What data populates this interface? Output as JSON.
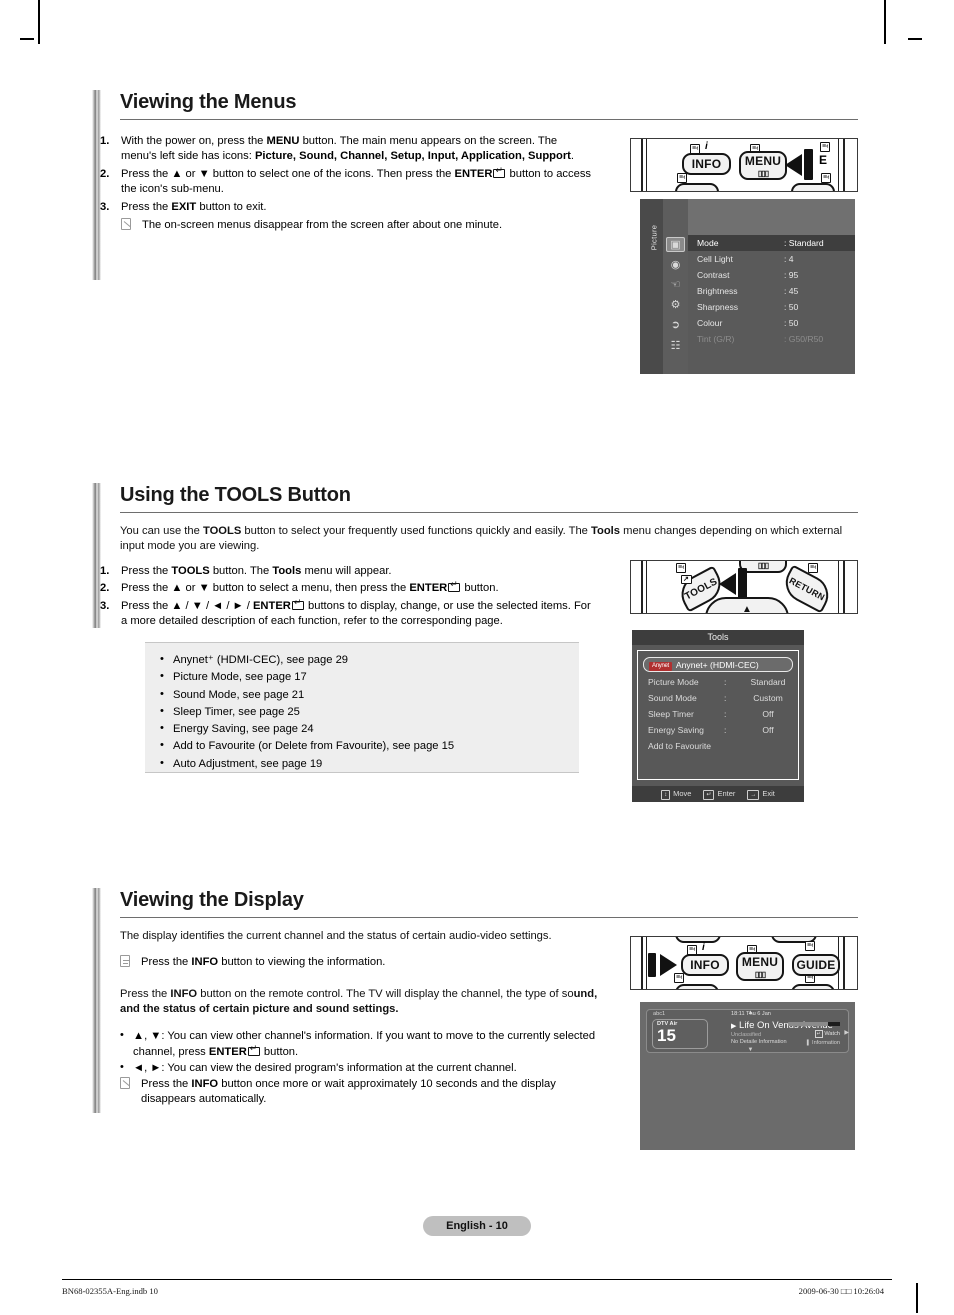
{
  "sections": [
    {
      "id": "viewing-menus",
      "title": "Viewing the Menus",
      "steps": [
        {
          "num": "1.",
          "html": "With the power on, press the <b>MENU</b> button. The main menu appears on the screen. The menu's left side has icons: <b>Picture, Sound, Channel, Setup, Input, Application, Support</b>."
        },
        {
          "num": "2.",
          "html": "Press the ▲ or ▼ button to select one of the icons. Then press the <b>ENTER</b><key></key> button to access the icon's sub-menu."
        },
        {
          "num": "3.",
          "html": "Press the <b>EXIT</b> button to exit."
        }
      ],
      "note": "The on-screen menus disappear from the screen after about one minute."
    },
    {
      "id": "using-tools",
      "title": "Using the TOOLS Button",
      "intro": "You can use the <b>TOOLS</b> button to select your frequently used functions quickly and easily. The <b>Tools</b> menu changes depending on which external input mode you are viewing.",
      "steps": [
        {
          "num": "1.",
          "html": "Press the <b>TOOLS</b> button. The <b>Tools</b> menu will appear."
        },
        {
          "num": "2.",
          "html": "Press the ▲ or ▼ button to select a menu, then press the <b>ENTER</b><key></key> button."
        },
        {
          "num": "3.",
          "html": "Press the ▲ / ▼ / ◄ / ► / <b>ENTER</b><key></key> buttons to display, change, or use the selected items. For a more detailed description of each function, refer to the corresponding page."
        }
      ],
      "list_box": [
        "Anynet⁺ (HDMI-CEC), see page 29",
        "Picture Mode, see page 17",
        "Sound Mode, see page 21",
        "Sleep Timer, see page 25",
        "Energy Saving, see page 24",
        "Add to Favourite (or Delete from Favourite), see page 15",
        "Auto Adjustment, see page 19"
      ]
    },
    {
      "id": "viewing-display",
      "title": "Viewing the Display",
      "intro": "The display identifies the current channel and the status of certain audio-video settings.",
      "note_top": "Press the <b>INFO</b> button to viewing the information.",
      "para": "Press the <b>INFO</b> button on the remote control. The TV will display the channel, the type of so<b>und, and the status of certain picture and sound settings.</b>",
      "bullets": [
        "▲, ▼: You can view other channel's information. If you want to move to the currently selected channel, press <b>ENTER</b><key></key> button.",
        "◄, ►: You can view the desired program's information at the current channel."
      ],
      "note_bottom": "Press the <b>INFO</b> button once more or wait approximately 10 seconds and the display disappears automatically."
    }
  ],
  "remotes": {
    "menu_remote": {
      "buttons": [
        "INFO",
        "MENU",
        "E"
      ],
      "mini_labels": [
        "≡‹",
        "i",
        "≡‹",
        "≡‹",
        "≡‹",
        "≡‹"
      ]
    },
    "tools_remote": {
      "buttons": [
        "TOOLS",
        "RETURN"
      ]
    },
    "info_remote": {
      "buttons": [
        "INFO",
        "MENU",
        "GUIDE"
      ]
    }
  },
  "picture_osd": {
    "side_label": "Picture",
    "rows": [
      {
        "label": "Mode",
        "value": ": Standard",
        "selected": true,
        "dim": false
      },
      {
        "label": "Cell Light",
        "value": ": 4",
        "selected": false,
        "dim": false
      },
      {
        "label": "Contrast",
        "value": ": 95",
        "selected": false,
        "dim": false
      },
      {
        "label": "Brightness",
        "value": ": 45",
        "selected": false,
        "dim": false
      },
      {
        "label": "Sharpness",
        "value": ": 50",
        "selected": false,
        "dim": false
      },
      {
        "label": "Colour",
        "value": ": 50",
        "selected": false,
        "dim": false
      },
      {
        "label": "Tint (G/R)",
        "value": ": G50/R50",
        "selected": false,
        "dim": true
      }
    ],
    "icons": [
      "picture-icon",
      "sound-icon",
      "channel-icon",
      "setup-icon",
      "input-icon",
      "support-icon"
    ]
  },
  "tools_osd": {
    "title": "Tools",
    "selected_badge": "Anynet",
    "selected_label": "Anynet+ (HDMI-CEC)",
    "rows": [
      {
        "label": "Picture Mode",
        "colon": ":",
        "value": "Standard"
      },
      {
        "label": "Sound Mode",
        "colon": ":",
        "value": "Custom"
      },
      {
        "label": "Sleep Timer",
        "colon": ":",
        "value": "Off"
      },
      {
        "label": "Energy Saving",
        "colon": ":",
        "value": "Off"
      },
      {
        "label": "Add to Favourite",
        "colon": "",
        "value": ""
      }
    ],
    "footer": [
      {
        "key": "↕",
        "label": "Move"
      },
      {
        "key": "↵",
        "label": "Enter"
      },
      {
        "key": "→",
        "label": "Exit"
      }
    ]
  },
  "info_banner": {
    "brand": "abc1",
    "source": "DTV Air",
    "channel": "15",
    "time": "18:11 Thu 6 Jan",
    "program": "Life On Venus Avenue",
    "rating": "Unclassified",
    "detail": "No Detaile Information",
    "action_watch": "Watch",
    "action_info": "Information"
  },
  "footer": {
    "page_tag": "English - 10",
    "left": "BN68-02355A-Eng.indb   10",
    "right": "2009-06-30   □□ 10:26:04"
  }
}
